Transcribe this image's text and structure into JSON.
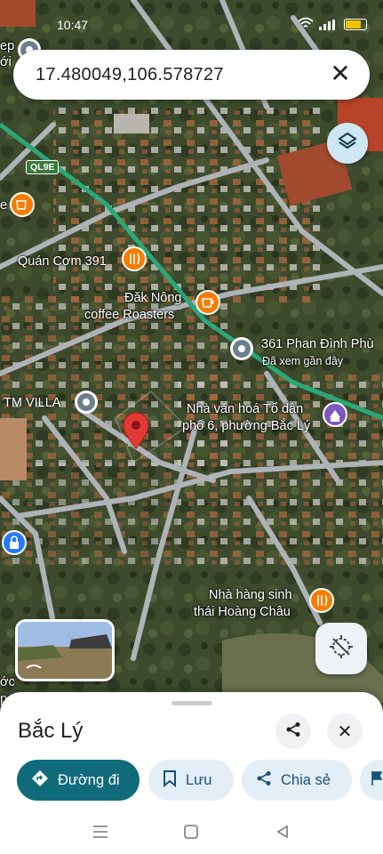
{
  "status_bar": {
    "time": "10:47"
  },
  "search": {
    "query": "17.480049,106.578727",
    "close_icon": "close-icon"
  },
  "map": {
    "road_badge": "QL9E",
    "labels": {
      "quan_com": "Quán Cơm 391",
      "dak_nong_1": "Đăk Nông",
      "dak_nong_2": "coffee Roasters",
      "phan_dinh_phung": "361 Phan Đình Phù",
      "recently_viewed": "Đã xem gần đây",
      "tm_villa": "TM VILLA",
      "nha_van_hoa_1": "Nhà văn hoá Tổ dân",
      "nha_van_hoa_2": "phố 6, phường Bắc Lý",
      "nha_hang_1": "Nhà hàng sinh",
      "nha_hang_2": "thái Hoàng Châu",
      "edge_top_1": "ep",
      "edge_top_2": "ới",
      "edge_e": "e",
      "edge_bottom_1": "ớc",
      "edge_bottom_2": "p"
    }
  },
  "place": {
    "name": "Bắc Lý",
    "actions": [
      {
        "label": "Đường đi",
        "icon": "directions-icon"
      },
      {
        "label": "Lưu",
        "icon": "bookmark-icon"
      },
      {
        "label": "Chia sẻ",
        "icon": "share-icon"
      }
    ]
  },
  "colors": {
    "accent": "#0f6b7a",
    "chip_bg": "#e4eef6",
    "pin": "#e53935",
    "food_pin": "#f57c00",
    "civic_pin": "#7e57c2"
  }
}
